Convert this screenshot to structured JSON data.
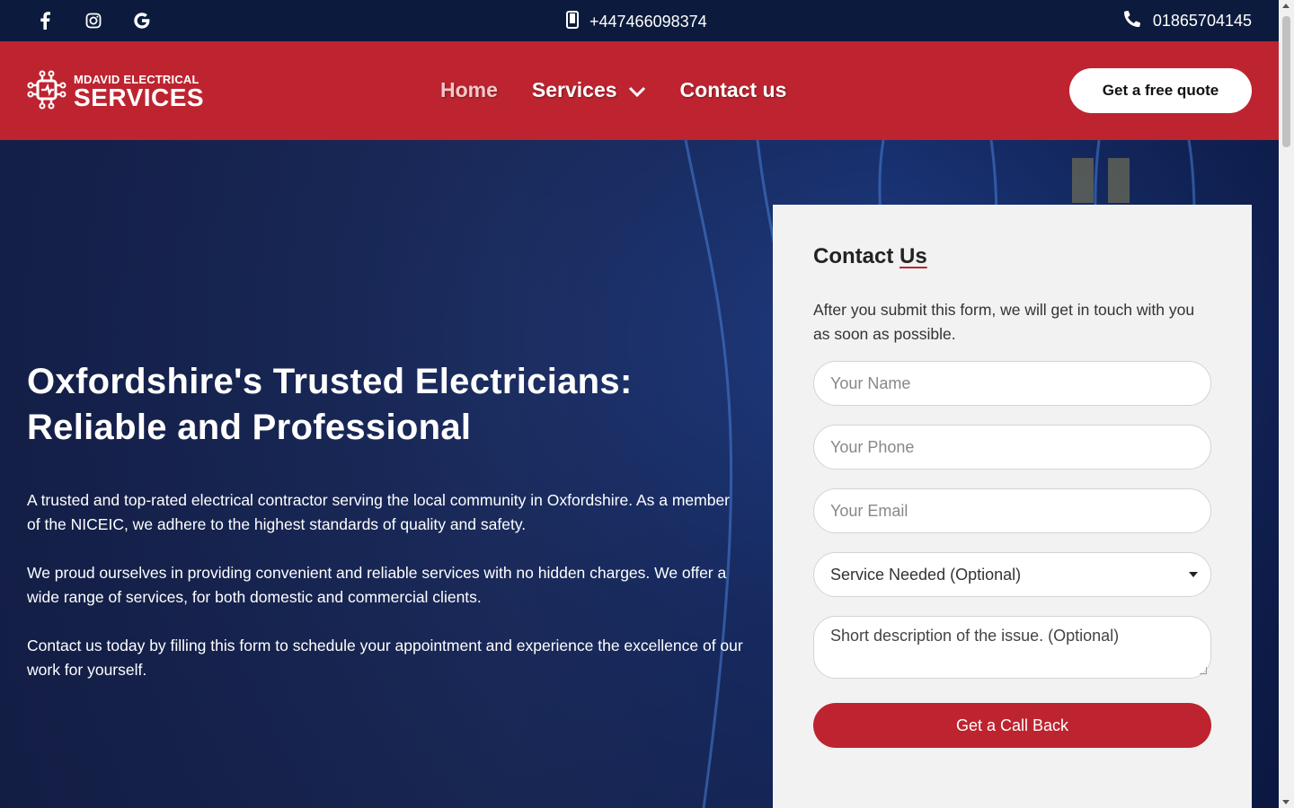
{
  "topbar": {
    "social": [
      {
        "icon": "facebook-icon",
        "glyph": "f"
      },
      {
        "icon": "instagram-icon",
        "glyph": "◎"
      },
      {
        "icon": "google-icon",
        "glyph": "G"
      }
    ],
    "mobile_phone": "+447466098374",
    "landline_phone": "01865704145"
  },
  "header": {
    "logo_top": "MDAVID ELECTRICAL",
    "logo_bottom": "SERVICES",
    "nav": {
      "home": "Home",
      "services": "Services",
      "contact": "Contact us"
    },
    "quote_button": "Get a free quote"
  },
  "hero": {
    "title_line1": "Oxfordshire's Trusted Electricians:",
    "title_line2": "Reliable and Professional",
    "paragraph1": "A trusted and top-rated electrical contractor serving the local community in Oxfordshire. As a member of the NICEIC, we adhere to the highest standards of quality and safety.",
    "paragraph2": "We proud ourselves in providing convenient and reliable services with no hidden charges. We offer a wide range of services, for both domestic and commercial clients.",
    "paragraph3": "Contact us today by filling this form to schedule your appointment and experience the excellence of our work for yourself."
  },
  "contact_form": {
    "title_plain": "Contact ",
    "title_underlined": "Us",
    "intro": "After you submit this form, we will get in touch with you as soon as possible.",
    "name_placeholder": "Your Name",
    "phone_placeholder": "Your Phone",
    "email_placeholder": "Your Email",
    "service_select_value": "Service Needed (Optional)",
    "description_placeholder": "Short description of the issue. (Optional)",
    "submit_label": "Get a Call Back"
  },
  "colors": {
    "brand_red": "#bd2430",
    "topbar_navy": "#0c1b3d",
    "card_bg": "#f2f2f2"
  }
}
